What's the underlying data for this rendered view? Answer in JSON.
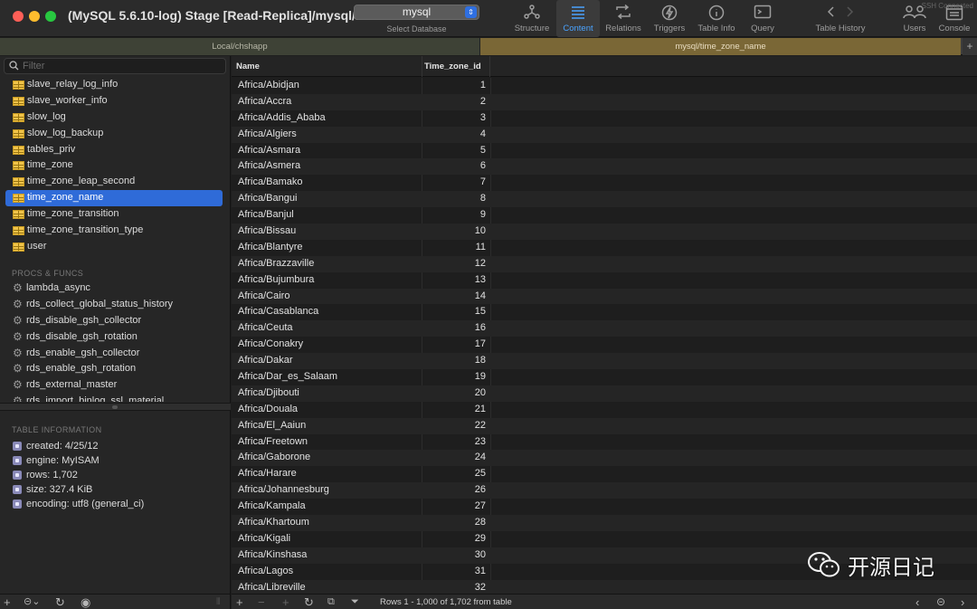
{
  "window": {
    "title": "(MySQL 5.6.10-log) Stage [Read-Replica]/mysql/...",
    "ssh_status": "SSH Connected"
  },
  "database_selector": {
    "value": "mysql",
    "caption": "Select Database"
  },
  "toolbar": [
    {
      "label": "Structure",
      "icon": "structure-icon"
    },
    {
      "label": "Content",
      "icon": "content-icon",
      "active": true
    },
    {
      "label": "Relations",
      "icon": "relations-icon"
    },
    {
      "label": "Triggers",
      "icon": "triggers-icon"
    },
    {
      "label": "Table Info",
      "icon": "info-icon"
    },
    {
      "label": "Query",
      "icon": "query-icon"
    },
    {
      "label": "Table History",
      "icon": "history-arrows-icon"
    },
    {
      "label": "Users",
      "icon": "users-icon"
    },
    {
      "label": "Console",
      "icon": "console-icon"
    }
  ],
  "tabs": [
    {
      "label": "Local/chshapp"
    },
    {
      "label": "mysql/time_zone_name",
      "active": true
    }
  ],
  "sidebar": {
    "filter_placeholder": "Filter",
    "tables": [
      "slave_relay_log_info",
      "slave_worker_info",
      "slow_log",
      "slow_log_backup",
      "tables_priv",
      "time_zone",
      "time_zone_leap_second",
      "time_zone_name",
      "time_zone_transition",
      "time_zone_transition_type",
      "user"
    ],
    "selected_table": "time_zone_name",
    "procs_label": "PROCS & FUNCS",
    "procs": [
      "lambda_async",
      "rds_collect_global_status_history",
      "rds_disable_gsh_collector",
      "rds_disable_gsh_rotation",
      "rds_enable_gsh_collector",
      "rds_enable_gsh_rotation",
      "rds_external_master",
      "rds_import_binlog_ssl_material"
    ],
    "info_label": "TABLE INFORMATION",
    "info": [
      "created: 4/25/12",
      "engine: MyISAM",
      "rows: 1,702",
      "size: 327.4 KiB",
      "encoding: utf8 (general_ci)"
    ]
  },
  "grid": {
    "columns": [
      "Name",
      "Time_zone_id"
    ],
    "rows": [
      [
        "Africa/Abidjan",
        "1"
      ],
      [
        "Africa/Accra",
        "2"
      ],
      [
        "Africa/Addis_Ababa",
        "3"
      ],
      [
        "Africa/Algiers",
        "4"
      ],
      [
        "Africa/Asmara",
        "5"
      ],
      [
        "Africa/Asmera",
        "6"
      ],
      [
        "Africa/Bamako",
        "7"
      ],
      [
        "Africa/Bangui",
        "8"
      ],
      [
        "Africa/Banjul",
        "9"
      ],
      [
        "Africa/Bissau",
        "10"
      ],
      [
        "Africa/Blantyre",
        "11"
      ],
      [
        "Africa/Brazzaville",
        "12"
      ],
      [
        "Africa/Bujumbura",
        "13"
      ],
      [
        "Africa/Cairo",
        "14"
      ],
      [
        "Africa/Casablanca",
        "15"
      ],
      [
        "Africa/Ceuta",
        "16"
      ],
      [
        "Africa/Conakry",
        "17"
      ],
      [
        "Africa/Dakar",
        "18"
      ],
      [
        "Africa/Dar_es_Salaam",
        "19"
      ],
      [
        "Africa/Djibouti",
        "20"
      ],
      [
        "Africa/Douala",
        "21"
      ],
      [
        "Africa/El_Aaiun",
        "22"
      ],
      [
        "Africa/Freetown",
        "23"
      ],
      [
        "Africa/Gaborone",
        "24"
      ],
      [
        "Africa/Harare",
        "25"
      ],
      [
        "Africa/Johannesburg",
        "26"
      ],
      [
        "Africa/Kampala",
        "27"
      ],
      [
        "Africa/Khartoum",
        "28"
      ],
      [
        "Africa/Kigali",
        "29"
      ],
      [
        "Africa/Kinshasa",
        "30"
      ],
      [
        "Africa/Lagos",
        "31"
      ],
      [
        "Africa/Libreville",
        "32"
      ]
    ]
  },
  "status_bar": {
    "text": "Rows 1 - 1,000 of 1,702 from table"
  },
  "watermark": {
    "text": "开源日记"
  }
}
